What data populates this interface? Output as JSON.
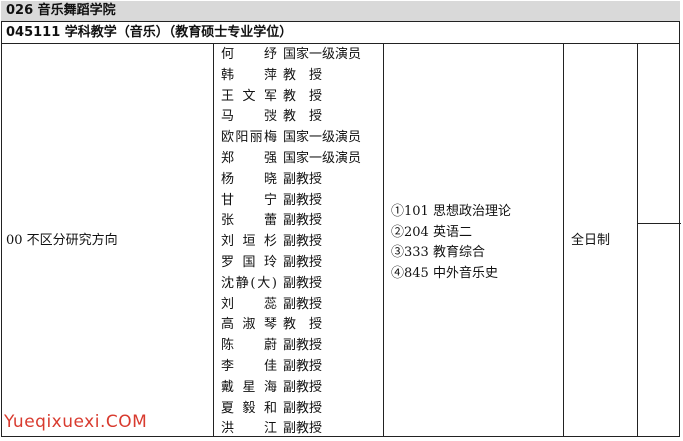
{
  "college": {
    "title": "026 音乐舞蹈学院"
  },
  "major": {
    "title": "045111 学科教学（音乐）（教育硕士专业学位）"
  },
  "direction": "00 不区分研究方向",
  "teachers": [
    {
      "name": "何 纾",
      "title": "国家一级演员"
    },
    {
      "name": "韩 萍",
      "title": "教授"
    },
    {
      "name": "王文军",
      "title": "教授"
    },
    {
      "name": "马 弢",
      "title": "教授"
    },
    {
      "name": "欧阳丽梅",
      "title": "国家一级演员"
    },
    {
      "name": "郑 强",
      "title": "国家一级演员"
    },
    {
      "name": "杨 晓",
      "title": "副教授"
    },
    {
      "name": "甘 宁",
      "title": "副教授"
    },
    {
      "name": "张 蕾",
      "title": "副教授"
    },
    {
      "name": "刘垣杉",
      "title": "副教授"
    },
    {
      "name": "罗国玲",
      "title": "副教授"
    },
    {
      "name": "沈静(大)",
      "title": "副教授"
    },
    {
      "name": "刘 蕊",
      "title": "副教授"
    },
    {
      "name": "高淑琴",
      "title": "教授"
    },
    {
      "name": "陈 蔚",
      "title": "副教授"
    },
    {
      "name": "李 佳",
      "title": "副教授"
    },
    {
      "name": "戴星海",
      "title": "副教授"
    },
    {
      "name": "夏毅和",
      "title": "副教授"
    },
    {
      "name": "洪 江",
      "title": "副教授"
    }
  ],
  "exams": [
    "①101 思想政治理论",
    "②204 英语二",
    "③333 教育综合",
    "④845 中外音乐史"
  ],
  "study_mode": "全日制",
  "watermark": "Yueqixuexi.COM"
}
